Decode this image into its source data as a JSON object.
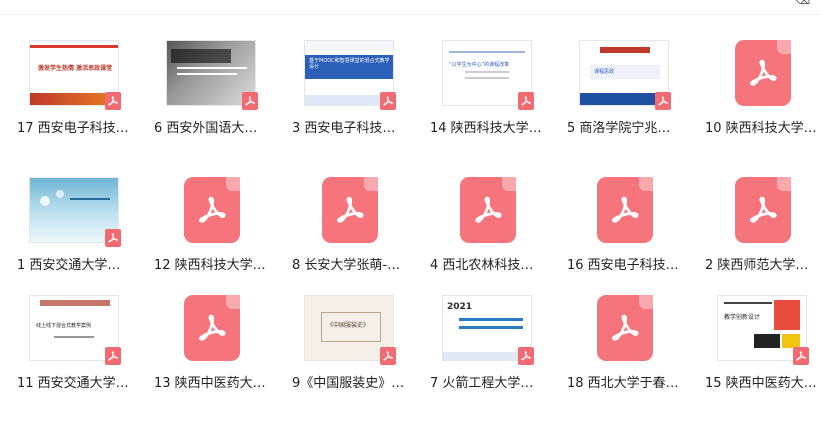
{
  "topbar": {
    "corner_glyph": "⌫"
  },
  "files": [
    {
      "label": "17 西安电子科技…",
      "thumb": "slide-red",
      "title": "激发学生热情 激活思政课堂"
    },
    {
      "label": "6 西安外国语大…",
      "thumb": "slide-book",
      "title": ""
    },
    {
      "label": "3 西安电子科技…",
      "thumb": "slide-blue",
      "title": "基于MOOC和智慧课堂的混合式教学设计"
    },
    {
      "label": "14 陕西科技大学…",
      "thumb": "slide-plain",
      "title": "“以学生为中心”的课程改革"
    },
    {
      "label": "5 商洛学院宁兆…",
      "thumb": "slide-college",
      "title": "课程思政"
    },
    {
      "label": "10 陕西科技大学…",
      "thumb": "pdf",
      "title": ""
    },
    {
      "label": "1 西安交通大学…",
      "thumb": "slide-tech",
      "title": ""
    },
    {
      "label": "12 陕西科技大学…",
      "thumb": "pdf",
      "title": ""
    },
    {
      "label": "8 长安大学张萌-…",
      "thumb": "pdf",
      "title": ""
    },
    {
      "label": "4 西北农林科技…",
      "thumb": "pdf",
      "title": ""
    },
    {
      "label": "16 西安电子科技…",
      "thumb": "pdf",
      "title": ""
    },
    {
      "label": "2 陕西师范大学…",
      "thumb": "pdf",
      "title": ""
    },
    {
      "label": "11 西安交通大学…",
      "thumb": "slide-xjtu",
      "title": "线上线下混合式教学案例"
    },
    {
      "label": "13 陕西中医药大…",
      "thumb": "pdf",
      "title": ""
    },
    {
      "label": "9《中国服装史》…",
      "thumb": "slide-fashion",
      "title": "《中国服装史》"
    },
    {
      "label": "7 火箭工程大学…",
      "thumb": "slide-2021",
      "title": "2021"
    },
    {
      "label": "18 西北大学于春…",
      "thumb": "pdf",
      "title": ""
    },
    {
      "label": "15 陕西中医药大…",
      "thumb": "slide-design",
      "title": "教学创新设计"
    }
  ],
  "icons": {
    "pdf": "pdf-acrobat-icon"
  }
}
